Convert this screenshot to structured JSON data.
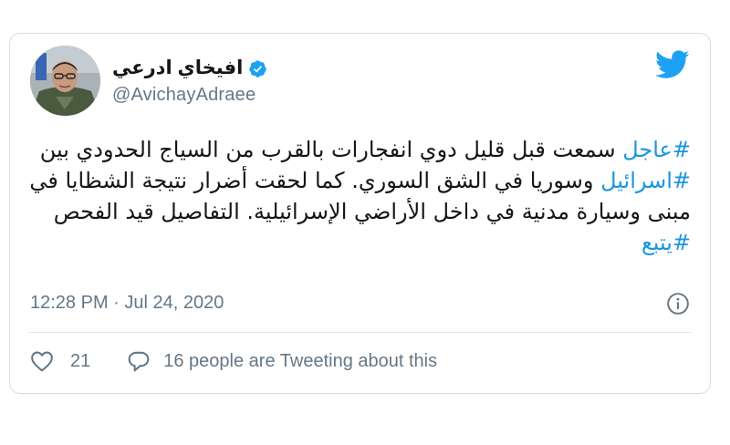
{
  "colors": {
    "link_blue": "#1b95e0",
    "twitter_blue": "#1da1f2",
    "secondary_text": "#657786",
    "border": "#d6dde3"
  },
  "author": {
    "display_name": "افيخاي ادرعي",
    "handle": "@AvichayAdraee",
    "verified": true,
    "verified_icon": "verified-badge-icon",
    "avatar_icon": "profile-photo"
  },
  "brand": {
    "logo_icon": "twitter-bird-icon"
  },
  "tweet": {
    "line1_hashtag": "#عاجل",
    "line1_text": " سمعت قبل قليل دوي انفجارات بالقرب من السياج الحدودي بين ",
    "line2_hashtag": "#اسرائيل",
    "line2_text": " وسوريا في الشق السوري. كما لحقت أضرار نتيجة الشظايا في مبنى وسيارة مدنية في داخل الأراضي الإسرائيلية. التفاصيل قيد الفحص ",
    "line3_hashtag": "#يتبع"
  },
  "meta": {
    "timestamp": "12:28 PM · Jul 24, 2020",
    "info_icon": "info-icon"
  },
  "actions": {
    "like_icon": "heart-icon",
    "like_count": "21",
    "reply_icon": "speech-bubble-icon",
    "tweeting_text": "16 people are Tweeting about this"
  }
}
